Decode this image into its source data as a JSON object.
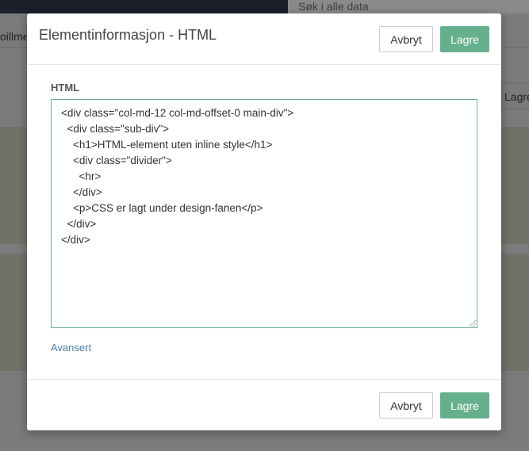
{
  "background": {
    "search_placeholder": "Søk i alle data",
    "left_fragment": "oillme",
    "right_button_fragment": "Lagre"
  },
  "modal": {
    "title": "Elementinformasjon - HTML",
    "header": {
      "cancel_label": "Avbryt",
      "save_label": "Lagre"
    },
    "field_label": "HTML",
    "code_lines": [
      "<div class=\"col-md-12 col-md-offset-0 main-div\">",
      "  <div class=\"sub-div\">",
      "    <h1>HTML-element uten inline style</h1>",
      "    <div class=\"divider\">",
      "      <hr>",
      "    </div>",
      "    <p>CSS er lagt under design-fanen</p>",
      "  </div>",
      "</div>"
    ],
    "advanced_link": "Avansert",
    "footer": {
      "cancel_label": "Avbryt",
      "save_label": "Lagre"
    }
  },
  "colors": {
    "accent": "#66b08e",
    "link": "#4a7da8"
  }
}
